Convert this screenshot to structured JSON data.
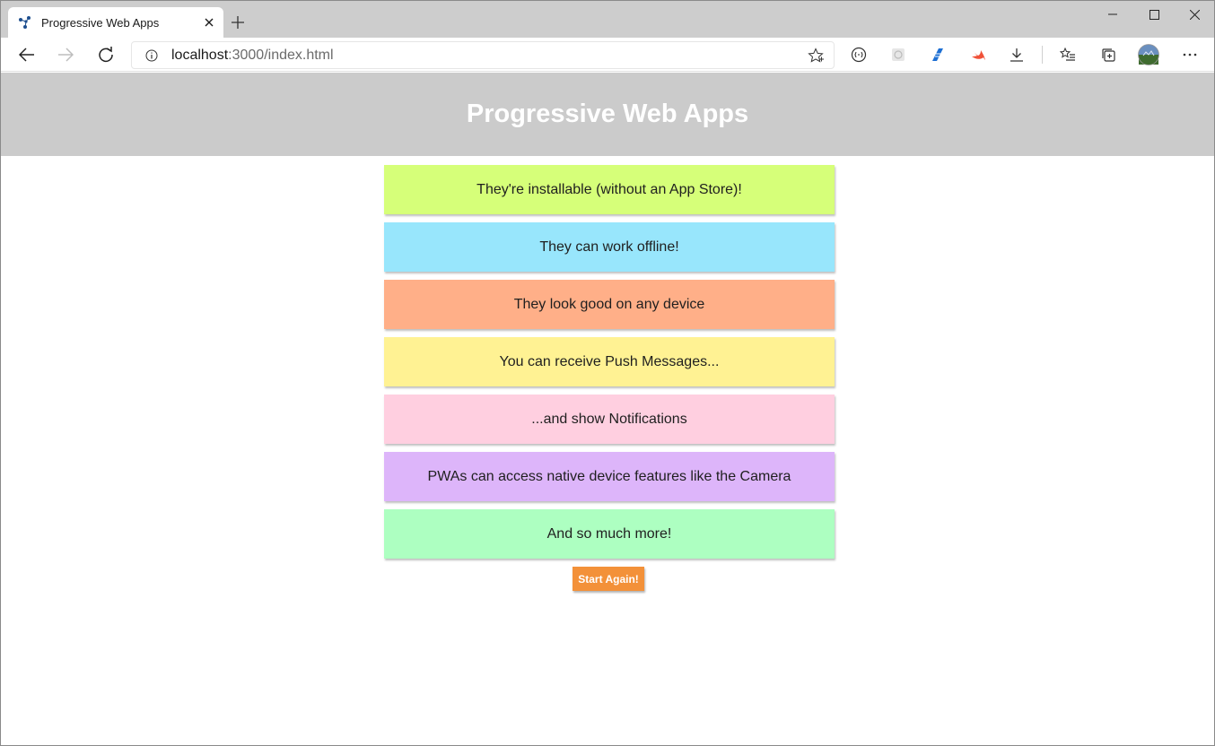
{
  "browser": {
    "tab": {
      "title": "Progressive Web Apps"
    },
    "url": {
      "host": "localhost",
      "path": ":3000/index.html"
    }
  },
  "page": {
    "title": "Progressive Web Apps",
    "cards": [
      {
        "text": "They're installable (without an App Store)!",
        "color": "#d6ff79"
      },
      {
        "text": "They can work offline!",
        "color": "#98e6fc"
      },
      {
        "text": "They look good on any device",
        "color": "#ffaf88"
      },
      {
        "text": "You can receive Push Messages...",
        "color": "#fff293"
      },
      {
        "text": "...and show Notifications",
        "color": "#ffcfe0"
      },
      {
        "text": "PWAs can access native device features like the Camera",
        "color": "#ddb5fa"
      },
      {
        "text": "And so much more!",
        "color": "#adffc1"
      }
    ],
    "start_button": "Start Again!"
  }
}
